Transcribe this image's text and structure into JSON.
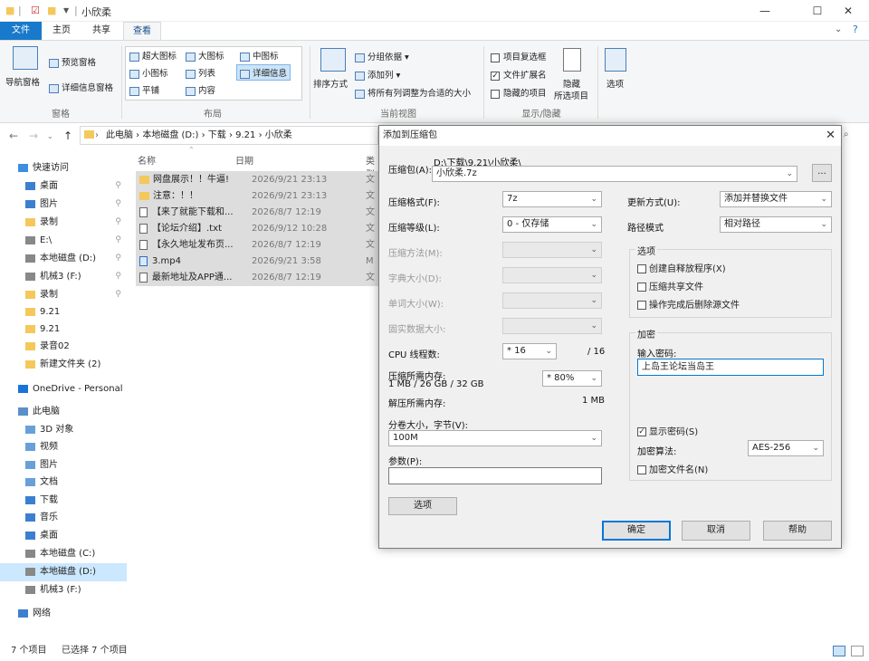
{
  "window": {
    "title": "小欣柔",
    "minimize": "—",
    "maximize": "☐",
    "close": "✕"
  },
  "ribbon": {
    "tabs": [
      "文件",
      "主页",
      "共享",
      "查看"
    ],
    "panes": {
      "nav_pane": "导航窗格",
      "preview_pane": "预览窗格",
      "details_pane": "详细信息窗格",
      "group_label": "窗格"
    },
    "layout": {
      "items": [
        "超大图标",
        "大图标",
        "中图标",
        "小图标",
        "列表",
        "详细信息",
        "平铺",
        "内容"
      ],
      "selected": "详细信息",
      "group_label": "布局"
    },
    "current_view": {
      "sort": "排序方式",
      "group_by": "分组依据",
      "add_column": "添加列",
      "fit_columns": "将所有列调整为合适的大小",
      "group_label": "当前视图"
    },
    "show_hide": {
      "item_checkbox": "项目复选框",
      "file_ext": "文件扩展名",
      "hidden_items": "隐藏的项目",
      "hide_selected": "隐藏",
      "hide_selected2": "所选项目",
      "group_label": "显示/隐藏"
    },
    "options": "选项"
  },
  "address": {
    "path": "此电脑 › 本地磁盘 (D:) › 下载 › 9.21 › 小欣柔"
  },
  "sidebar": {
    "items": [
      {
        "label": "快速访问",
        "pinned": false
      },
      {
        "label": "桌面",
        "pinned": true
      },
      {
        "label": "图片",
        "pinned": true
      },
      {
        "label": "录制",
        "pinned": true
      },
      {
        "label": "E:\\",
        "pinned": true
      },
      {
        "label": "本地磁盘 (D:)",
        "pinned": true
      },
      {
        "label": "机械3 (F:)",
        "pinned": true
      },
      {
        "label": "录制",
        "pinned": true
      },
      {
        "label": "9.21",
        "pinned": false
      },
      {
        "label": "9.21",
        "pinned": false
      },
      {
        "label": "录音02",
        "pinned": false
      },
      {
        "label": "新建文件夹 (2)",
        "pinned": false
      },
      {
        "label": "OneDrive - Personal",
        "pinned": false
      },
      {
        "label": "此电脑",
        "pinned": false
      },
      {
        "label": "3D 对象",
        "pinned": false
      },
      {
        "label": "视频",
        "pinned": false
      },
      {
        "label": "图片",
        "pinned": false
      },
      {
        "label": "文档",
        "pinned": false
      },
      {
        "label": "下载",
        "pinned": false
      },
      {
        "label": "音乐",
        "pinned": false
      },
      {
        "label": "桌面",
        "pinned": false
      },
      {
        "label": "本地磁盘 (C:)",
        "pinned": false
      },
      {
        "label": "本地磁盘 (D:)",
        "pinned": false
      },
      {
        "label": "机械3 (F:)",
        "pinned": false
      },
      {
        "label": "网络",
        "pinned": false
      }
    ],
    "selected_index": 22
  },
  "filelist": {
    "columns": [
      "名称",
      "日期",
      "类型"
    ],
    "rows": [
      {
        "name": "网盘展示！！牛逼!",
        "date": "2026/9/21 23:13",
        "type": "文",
        "kind": "folder"
      },
      {
        "name": "注意：！！",
        "date": "2026/9/21 23:13",
        "type": "文",
        "kind": "folder"
      },
      {
        "name": "【来了就能下载和...",
        "date": "2026/8/7 12:19",
        "type": "文",
        "kind": "doc"
      },
      {
        "name": "【论坛介绍】.txt",
        "date": "2026/9/12 10:28",
        "type": "文",
        "kind": "doc"
      },
      {
        "name": "【永久地址发布页...",
        "date": "2026/8/7 12:19",
        "type": "文",
        "kind": "doc"
      },
      {
        "name": "3.mp4",
        "date": "2026/9/21 3:58",
        "type": "M",
        "kind": "video"
      },
      {
        "name": "最新地址及APP通...",
        "date": "2026/8/7 12:19",
        "type": "文",
        "kind": "doc"
      }
    ]
  },
  "status": {
    "count": "7 个项目",
    "selected": "已选择 7 个项目"
  },
  "dialog": {
    "title": "添加到压缩包",
    "close": "✕",
    "archive_label": "压缩包(A):",
    "archive_dir": "D:\\下载\\9.21\\小欣柔\\",
    "archive_name": "小欣柔.7z",
    "browse": "...",
    "format_label": "压缩格式(F):",
    "format_value": "7z",
    "level_label": "压缩等级(L):",
    "level_value": "0 - 仅存储",
    "method_label": "压缩方法(M):",
    "dict_label": "字典大小(D):",
    "word_label": "单词大小(W):",
    "solid_label": "固实数据大小:",
    "cpu_label": "CPU 线程数:",
    "cpu_value": "* 16",
    "cpu_max": "/ 16",
    "mem_label": "压缩所需内存:",
    "mem_detail": "1 MB / 26 GB / 32 GB",
    "mem_value": "* 80%",
    "decomp_label": "解压所需内存:",
    "decomp_value": "1 MB",
    "split_label": "分卷大小，字节(V):",
    "split_value": "100M",
    "params_label": "参数(P):",
    "params_value": "",
    "options_btn": "选项",
    "update_label": "更新方式(U):",
    "update_value": "添加并替换文件",
    "path_label": "路径模式",
    "path_value": "相对路径",
    "options_group": "选项",
    "opt_sfx": "创建自释放程序(X)",
    "opt_shared": "压缩共享文件",
    "opt_delete": "操作完成后删除源文件",
    "enc_group": "加密",
    "pw_label": "输入密码:",
    "pw_value": "上岛王论坛当岛王",
    "show_pw": "显示密码(S)",
    "enc_method_label": "加密算法:",
    "enc_method_value": "AES-256",
    "enc_names": "加密文件名(N)",
    "ok": "确定",
    "cancel": "取消",
    "help": "帮助"
  }
}
